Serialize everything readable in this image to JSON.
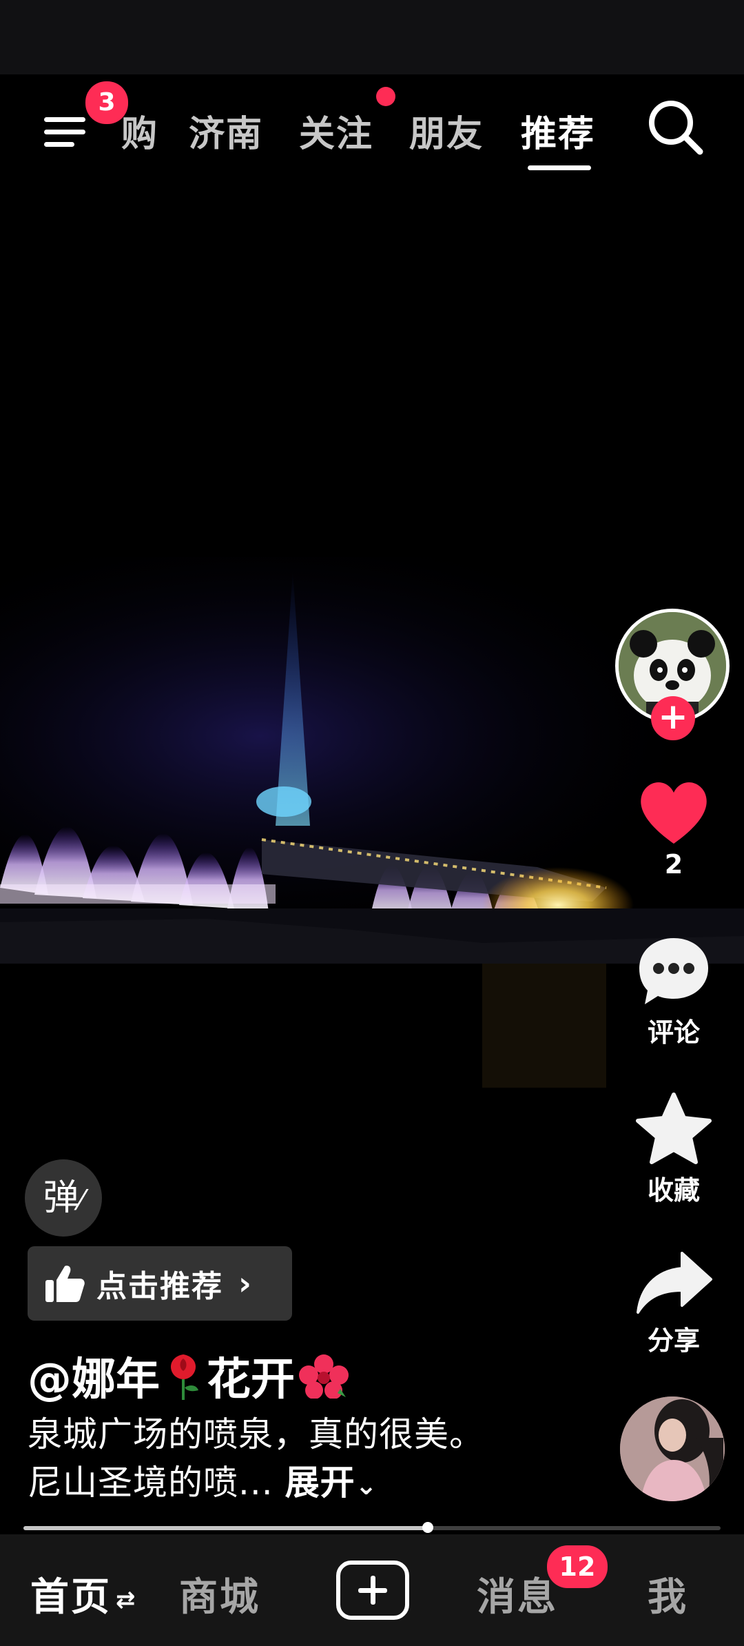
{
  "top_nav": {
    "menu_badge": "3",
    "tabs": [
      {
        "label": "购",
        "active": false
      },
      {
        "label": "济南",
        "active": false
      },
      {
        "label": "关注",
        "active": false,
        "has_dot": true
      },
      {
        "label": "朋友",
        "active": false
      },
      {
        "label": "推荐",
        "active": true
      }
    ],
    "search_icon": "search-icon"
  },
  "right_rail": {
    "follow_icon": "plus-icon",
    "like_count": "2",
    "comment_label": "评论",
    "favorite_label": "收藏",
    "share_label": "分享"
  },
  "content": {
    "danmaku_label": "弹",
    "recommend_label": "点击推荐",
    "author_prefix": "@娜年",
    "author_suffix": "花开",
    "caption": "泉城广场的喷泉，真的很美。尼山圣境的喷...",
    "expand_label": "展开"
  },
  "progress": {
    "fraction": 0.58
  },
  "bottom_nav": {
    "items": [
      {
        "label": "首页",
        "active": true
      },
      {
        "label": "商城",
        "active": false
      },
      {
        "label": "消息",
        "active": false
      },
      {
        "label": "我",
        "active": false
      }
    ],
    "message_badge": "12"
  },
  "colors": {
    "accent": "#fe2c55",
    "nav_bg": "#161616"
  }
}
